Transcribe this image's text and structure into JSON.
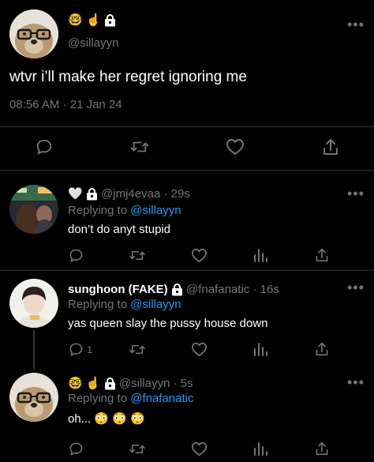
{
  "main_tweet": {
    "handle": "@sillayyn",
    "name_emojis": [
      "🤓",
      "☝️"
    ],
    "text": "wtvr i’ll make her regret ignoring me",
    "time": "08:56 AM",
    "sep": "·",
    "date": "21 Jan 24"
  },
  "replies": [
    {
      "name_emoji": "🤍",
      "handle": "@jmj4evaa",
      "sep": "·",
      "time": "29s",
      "replying_prefix": "Replying to",
      "replying_to": "@sillayyn",
      "text": "don’t do anyt stupid"
    },
    {
      "display_name": "sunghoon (FAKE)",
      "handle": "@fnafanatic",
      "sep": "·",
      "time": "16s",
      "replying_prefix": "Replying to",
      "replying_to": "@sillayyn",
      "text": "yas queen slay the pussy house down",
      "reply_count": "1"
    },
    {
      "name_emojis": [
        "🤓",
        "☝️"
      ],
      "handle": "@sillayyn",
      "sep": "·",
      "time": "5s",
      "replying_prefix": "Replying to",
      "replying_to": "@fnafanatic",
      "text": "oh...",
      "text_emojis": [
        "😳",
        "😳",
        "😳"
      ]
    }
  ],
  "more_icon": "•••",
  "colors": {
    "background": "#000000",
    "muted": "#71767b",
    "link": "#1d9bf0",
    "divider": "#2f3336"
  }
}
